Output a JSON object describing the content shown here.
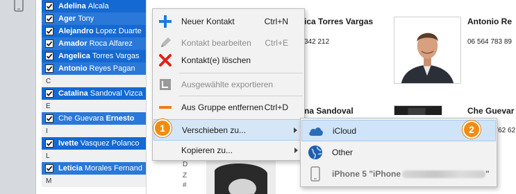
{
  "contact_list": [
    {
      "kind": "contact",
      "first": "Adelina",
      "last": "Alcala",
      "selected": true
    },
    {
      "kind": "contact",
      "first": "Ager",
      "last": "Tony",
      "selected": true
    },
    {
      "kind": "contact",
      "first": "Alejandro",
      "last": "Lopez Duarte",
      "selected": true
    },
    {
      "kind": "contact",
      "first": "Amador",
      "last": "Roca Alfarez",
      "selected": true
    },
    {
      "kind": "contact",
      "first": "Angelica",
      "last": "Torres Vargas",
      "selected": true
    },
    {
      "kind": "contact",
      "first": "Antonio",
      "last": "Reyes Pagan",
      "selected": true
    },
    {
      "kind": "letter",
      "text": "C"
    },
    {
      "kind": "contact",
      "first": "Catalina",
      "last": "Sandoval Vizca",
      "selected": true
    },
    {
      "kind": "letter",
      "text": "E"
    },
    {
      "kind": "contact",
      "first": "Che Guevara",
      "last": "Ernesto",
      "selected": true,
      "bold_last": true
    },
    {
      "kind": "letter",
      "text": "I"
    },
    {
      "kind": "contact",
      "first": "Ivette",
      "last": "Vasquez Polanco",
      "selected": true
    },
    {
      "kind": "letter",
      "text": "L"
    },
    {
      "kind": "contact",
      "first": "Leticia",
      "last": "Morales Fernand",
      "selected": true
    },
    {
      "kind": "letter",
      "text": "M"
    }
  ],
  "alphabet_index": [
    "D",
    "Z",
    "#"
  ],
  "cards": {
    "top_left_name": "ica Torres Vargas",
    "top_left_phone": "342 212",
    "top_right_name": "Antonio Re",
    "top_right_phone": "06 564 783 89",
    "bottom_left_name": "na Sandoval",
    "bottom_right_name": "Che Guevar",
    "bottom_right_phone": "7762 62"
  },
  "context_menu": {
    "new_contact": {
      "label": "Neuer Kontakt",
      "shortcut": "Ctrl+N"
    },
    "edit_contact": {
      "label": "Kontakt bearbeiten",
      "shortcut": "Ctrl+E"
    },
    "delete_contact": {
      "label": "Kontakt(e) löschen"
    },
    "export_selected": {
      "label": "Ausgewählte exportieren"
    },
    "remove_from_group": {
      "label": "Aus Gruppe entfernen",
      "shortcut": "Ctrl+D"
    },
    "move_to": {
      "label": "Verschieben zu..."
    },
    "copy_to": {
      "label": "Kopieren zu..."
    }
  },
  "submenu": {
    "icloud": "iCloud",
    "other": "Other",
    "device_prefix": "iPhone 5 \"iPhone",
    "device_suffix": "\""
  },
  "badges": {
    "step1": "1",
    "step2": "2"
  },
  "colors": {
    "selection_blue": "#1469d3",
    "menu_highlight": "#d5e6f7",
    "badge_orange": "#f08c12",
    "delete_red": "#e0221a",
    "add_blue": "#1a7be0",
    "remove_orange": "#f07c1c"
  },
  "icons": {
    "device": "phone-icon",
    "new_contact": "plus-icon",
    "edit_contact": "pencil-icon",
    "delete_contact": "x-icon",
    "export_selected": "export-icon",
    "remove_from_group": "minus-icon",
    "icloud": "cloud-icon",
    "other": "globe-icon",
    "device_item": "iphone-icon"
  }
}
